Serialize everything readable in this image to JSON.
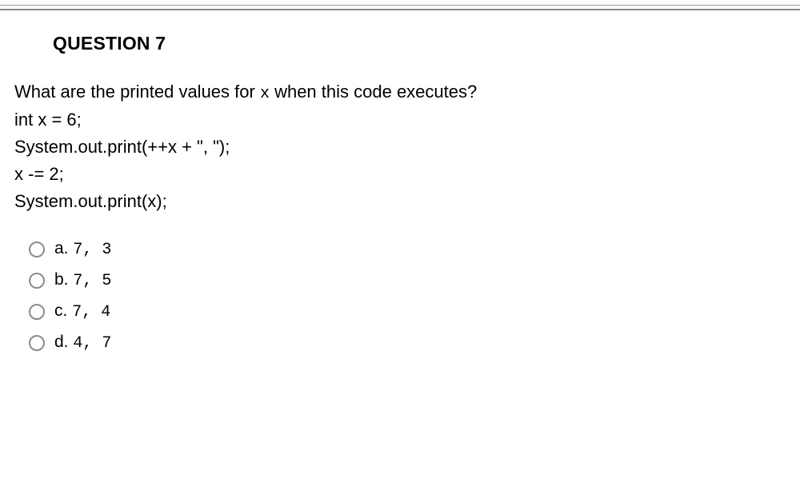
{
  "title": "QUESTION 7",
  "question": {
    "prompt_prefix": "What are the printed values for ",
    "prompt_var": "x",
    "prompt_suffix": " when this code executes?",
    "code": [
      "int x = 6;",
      "System.out.print(++x + \", \");",
      "x -= 2;",
      "System.out.print(x);"
    ]
  },
  "options": [
    {
      "letter": "a.",
      "value": "7,  3"
    },
    {
      "letter": "b.",
      "value": "7,  5"
    },
    {
      "letter": "c.",
      "value": "7,  4"
    },
    {
      "letter": "d.",
      "value": "4,  7"
    }
  ]
}
